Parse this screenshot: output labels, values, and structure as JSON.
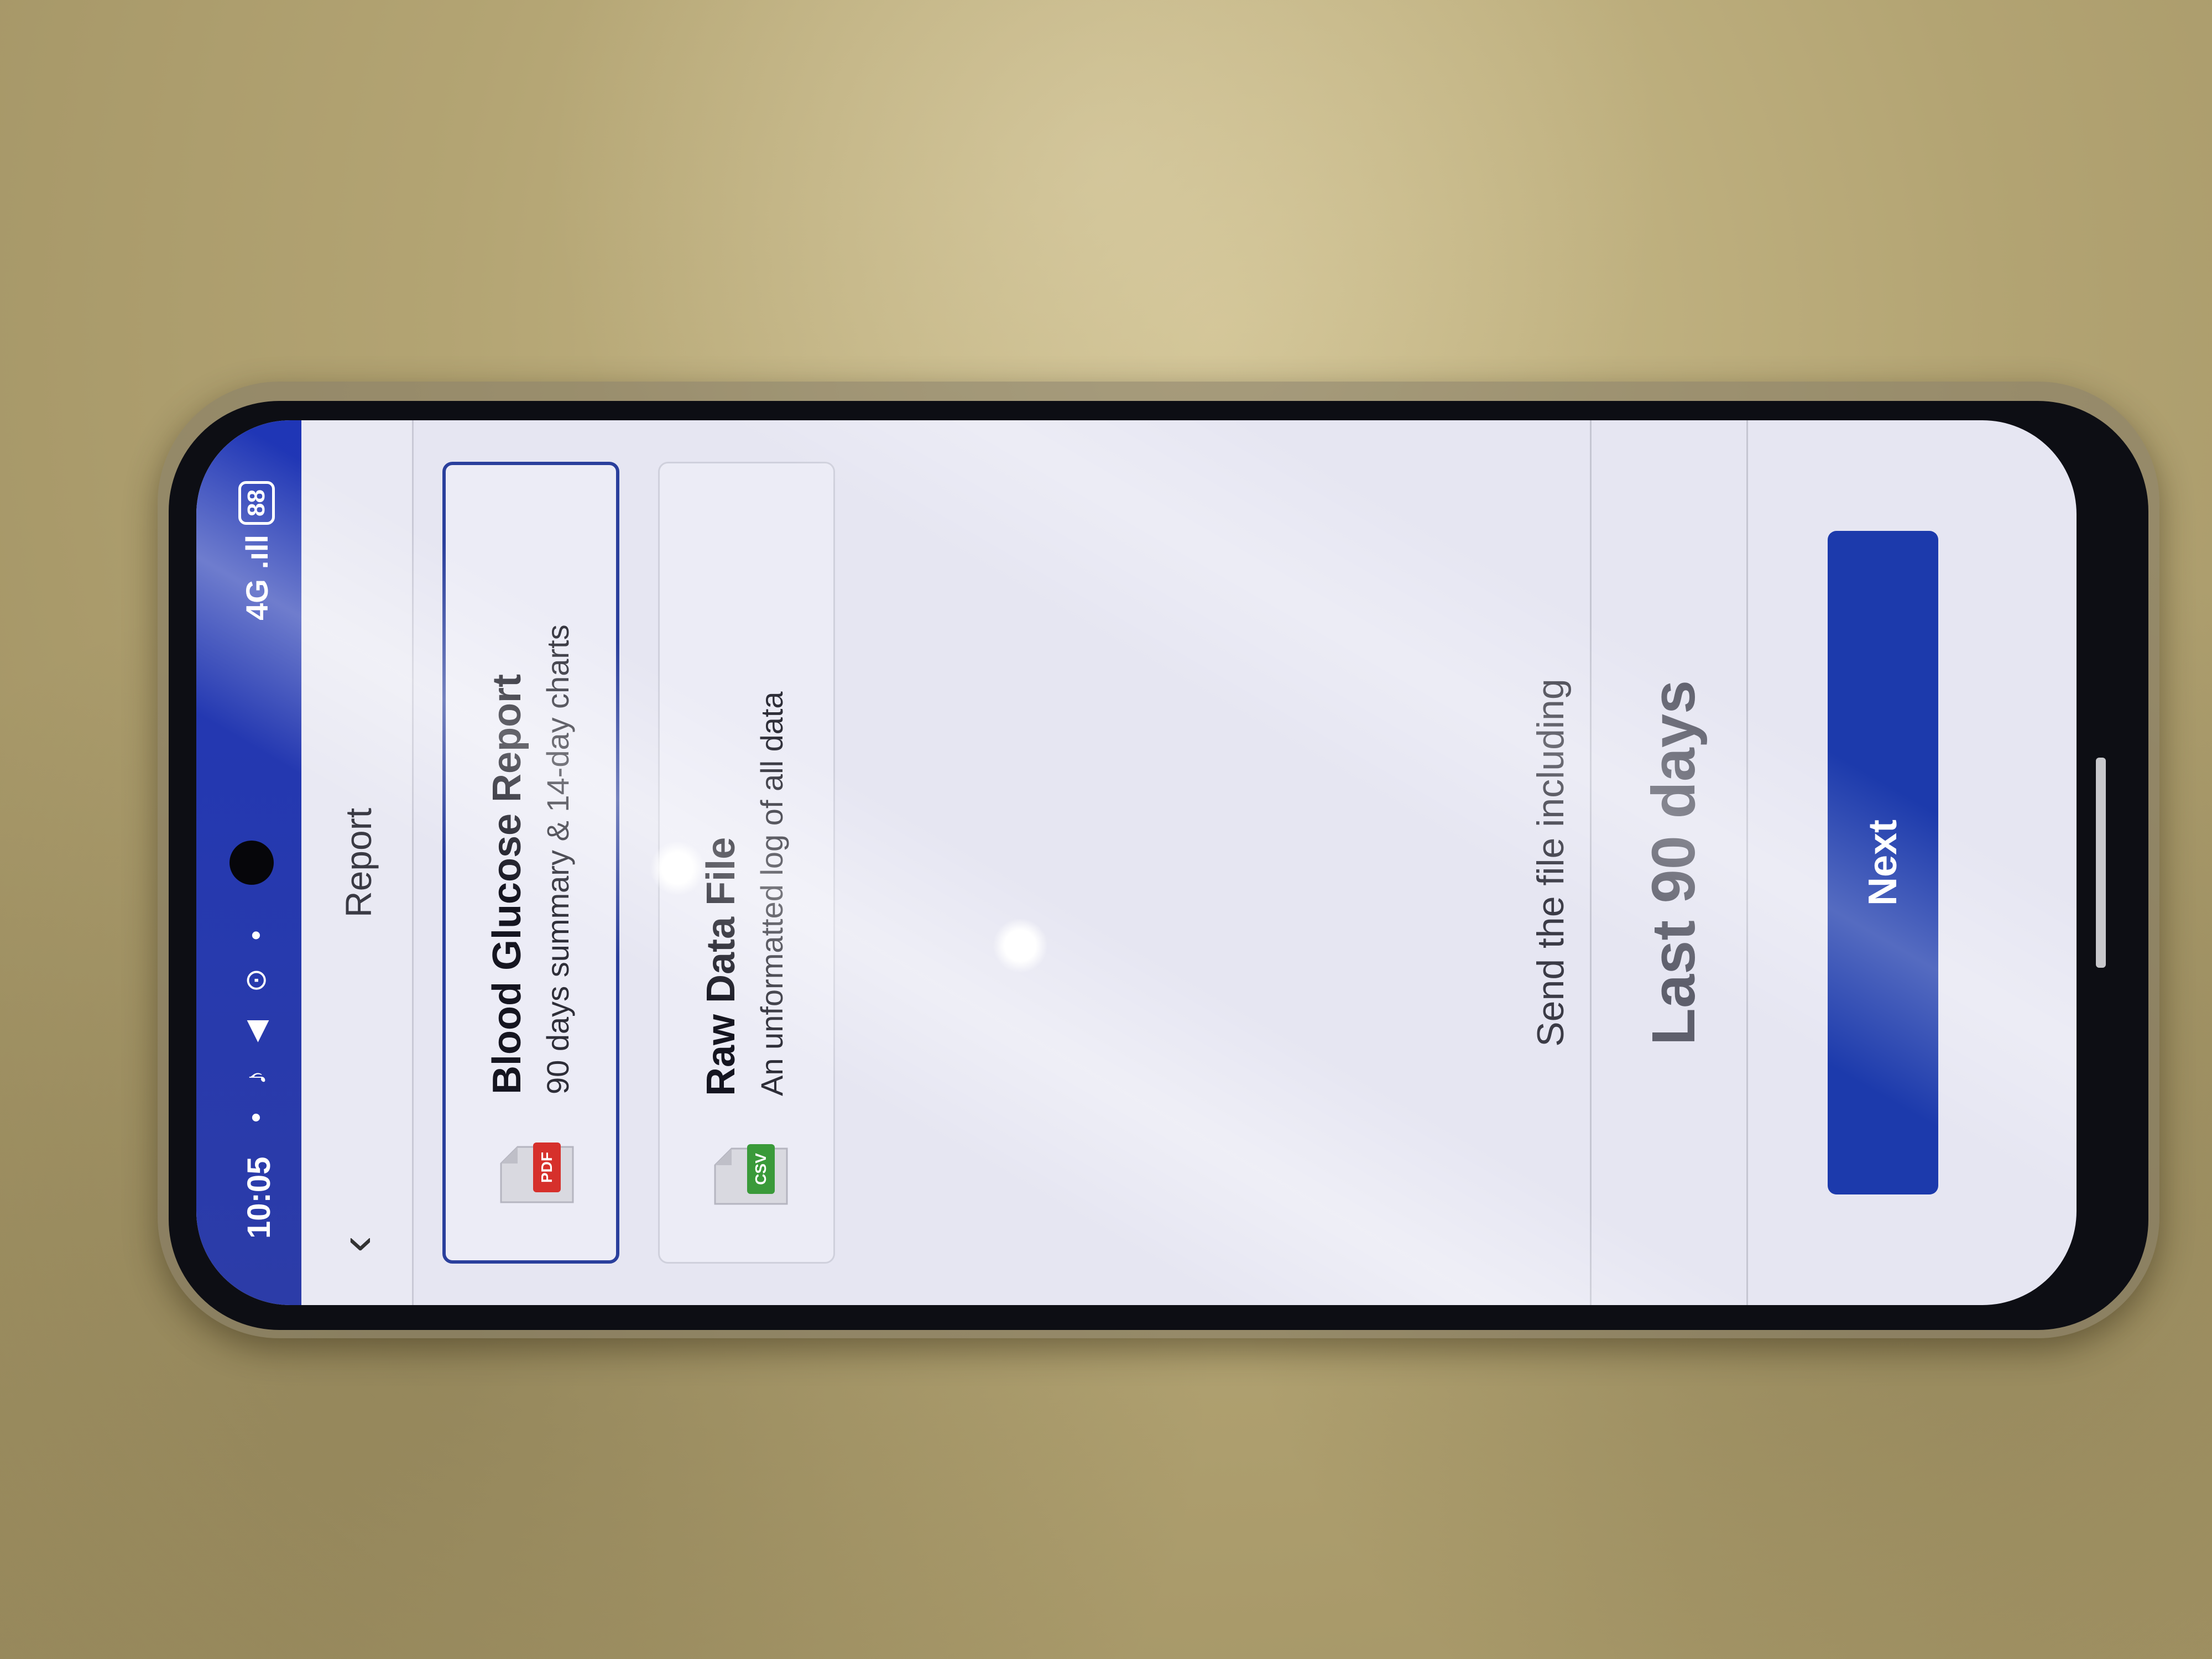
{
  "status_bar": {
    "time": "10:05",
    "icons": "• ♪ ◀ ⊙ •",
    "network": "4G",
    "signal": ".ıll",
    "battery": "88"
  },
  "app_bar": {
    "back_icon": "chevron-left-icon",
    "title": "Report"
  },
  "report_options": [
    {
      "title": "Blood Glucose Report",
      "subtitle": "90 days summary & 14-day charts",
      "badge": "PDF",
      "badge_color": "#d6302b",
      "selected": true
    },
    {
      "title": "Raw Data File",
      "subtitle": "An unformatted log of all data",
      "badge": "CSV",
      "badge_color": "#3a9a3a",
      "selected": false
    }
  ],
  "range": {
    "label": "Send the file including",
    "value": "Last 90 days"
  },
  "actions": {
    "next_label": "Next"
  },
  "colors": {
    "accent": "#1c3aac",
    "status_bar": "#1f36b6"
  }
}
